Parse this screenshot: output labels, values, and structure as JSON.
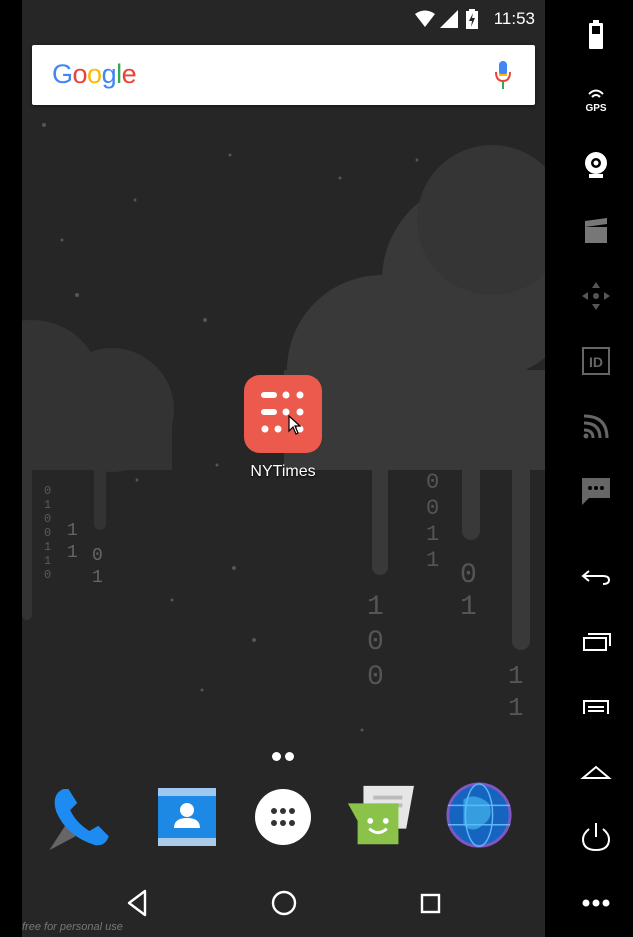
{
  "status_bar": {
    "time": "11:53"
  },
  "search_bar": {
    "logo_letters": [
      {
        "char": "G",
        "color": "#4285F4"
      },
      {
        "char": "o",
        "color": "#EA4335"
      },
      {
        "char": "o",
        "color": "#FBBC05"
      },
      {
        "char": "g",
        "color": "#4285F4"
      },
      {
        "char": "l",
        "color": "#34A853"
      },
      {
        "char": "e",
        "color": "#EA4335"
      }
    ]
  },
  "home_app": {
    "label": "NYTimes",
    "color": "#ec5a4e"
  },
  "wallpaper_digits": {
    "col1": "0 1 0 0 1 1 0",
    "col2": "1 1",
    "col3": "0 1",
    "col4": "1 0 0",
    "col5": "0 0 1 1",
    "col6": "0 1",
    "col7": "1 1"
  },
  "dock": [
    "phone-icon",
    "contacts-icon",
    "app-drawer-icon",
    "messaging-icon",
    "browser-icon"
  ],
  "watermark": "free for personal use",
  "emulator_toolbar": {
    "gps_label": "GPS",
    "id_label": "ID"
  }
}
